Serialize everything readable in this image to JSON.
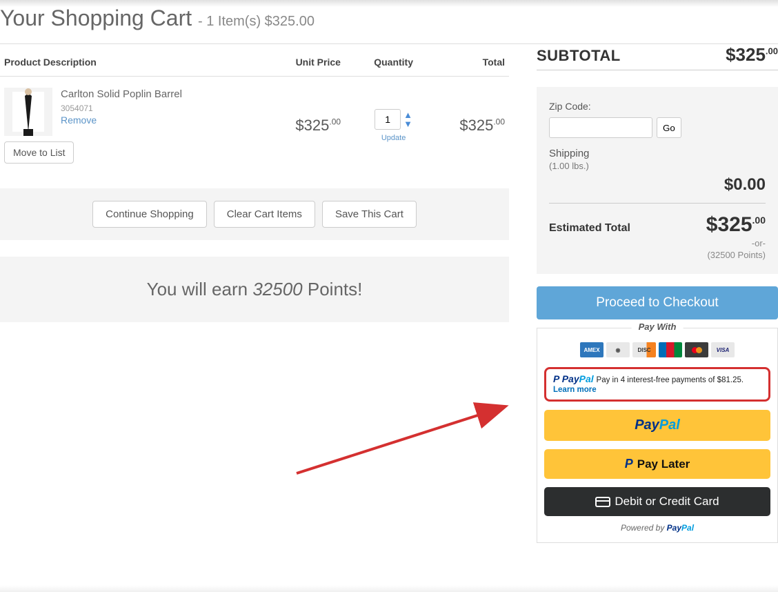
{
  "page": {
    "title": "Your Shopping Cart",
    "subtitle": "- 1 Item(s) $325.00"
  },
  "table": {
    "headers": {
      "product": "Product Description",
      "unit": "Unit Price",
      "qty": "Quantity",
      "total": "Total"
    },
    "item": {
      "name": "Carlton Solid Poplin Barrel",
      "sku": "3054071",
      "remove": "Remove",
      "unit_price": "$325",
      "unit_cents": ".00",
      "qty": "1",
      "update": "Update",
      "total": "$325",
      "total_cents": ".00",
      "move": "Move to List"
    }
  },
  "actions": {
    "continue": "Continue Shopping",
    "clear": "Clear Cart Items",
    "save": "Save This Cart"
  },
  "earn": {
    "prefix": "You will earn ",
    "points": "32500",
    "suffix": " Points!"
  },
  "summary": {
    "subtotal_label": "SUBTOTAL",
    "subtotal_amount": "$325",
    "subtotal_cents": ".00",
    "zip_label": "Zip Code:",
    "go": "Go",
    "shipping_label": "Shipping",
    "shipping_weight": "(1.00 lbs.)",
    "shipping_amount": "$0",
    "shipping_cents": ".00",
    "est_label": "Estimated Total",
    "est_amount": "$325",
    "est_cents": ".00",
    "or": "-or-",
    "points_alt": "(32500 Points)",
    "checkout": "Proceed to Checkout",
    "pay_with": "Pay With"
  },
  "paypal": {
    "msg": "Pay in 4 interest-free payments of $81.25.",
    "learn": "Learn more",
    "later": "Pay Later",
    "debit": "Debit or Credit Card",
    "powered": "Powered by "
  }
}
